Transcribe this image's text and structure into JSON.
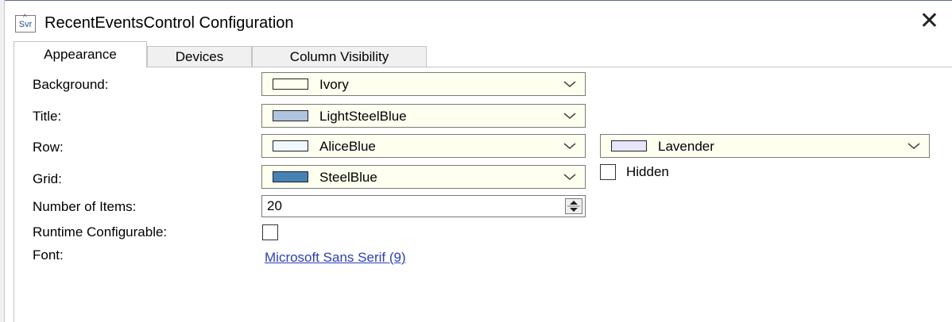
{
  "window": {
    "icon_text": "Svr",
    "title": "RecentEventsControl Configuration",
    "close_glyph": "✕"
  },
  "tabs": [
    {
      "label": "Appearance",
      "active": true
    },
    {
      "label": "Devices",
      "active": false
    },
    {
      "label": "Column Visibility",
      "active": false
    }
  ],
  "form": {
    "background": {
      "label": "Background:",
      "value": "Ivory",
      "swatch": "#fffff0"
    },
    "title": {
      "label": "Title:",
      "value": "LightSteelBlue",
      "swatch": "#b0c4de"
    },
    "row": {
      "label": "Row:",
      "value": "AliceBlue",
      "swatch": "#f0f8ff",
      "alt_value": "Lavender",
      "alt_swatch": "#e6e6fa"
    },
    "grid": {
      "label": "Grid:",
      "value": "SteelBlue",
      "swatch": "#4682b4",
      "hidden_label": "Hidden",
      "hidden_checked": false
    },
    "items": {
      "label": "Number of Items:",
      "value": "20"
    },
    "runtime": {
      "label": "Runtime Configurable:",
      "checked": false
    },
    "font": {
      "label": "Font:",
      "value": "Microsoft Sans Serif (9)"
    }
  },
  "colors": {
    "combo_bg": "#fffff0",
    "link": "#2b3fb5"
  }
}
